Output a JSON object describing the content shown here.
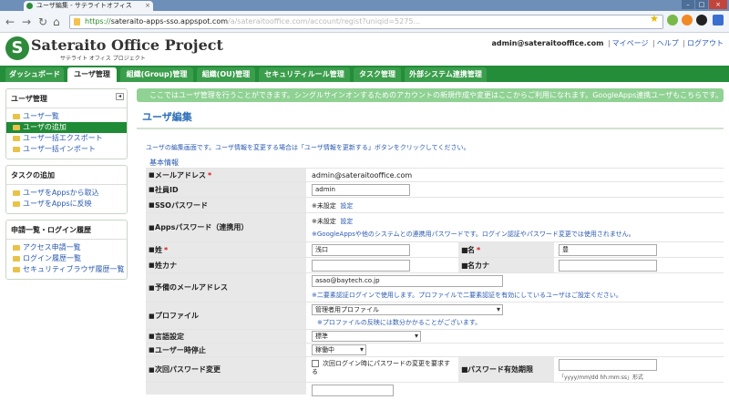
{
  "browser": {
    "tab_title": "ユーザ編集 - サテライトオフィス",
    "url_scheme": "https://",
    "url_host": "sateraito-apps-sso.appspot.com",
    "url_rest": "/a/sateraitooffice.com/account/regist?uniqid=5275..."
  },
  "header": {
    "brand": "Sateraito Office Project",
    "brand_sub": "サテライト オフィス プロジェクト",
    "user_email": "admin@sateraitooffice.com",
    "links": [
      "マイページ",
      "ヘルプ",
      "ログアウト"
    ]
  },
  "main_nav": [
    "ダッシュボード",
    "ユーザ管理",
    "組織(Group)管理",
    "組織(OU)管理",
    "セキュリティルール管理",
    "タスク管理",
    "外部システム連携管理"
  ],
  "sidebar": {
    "sections": [
      {
        "title": "ユーザ管理",
        "items": [
          "ユーザ一覧",
          "ユーザの追加",
          "ユーザ一括エクスポート",
          "ユーザ一括インポート"
        ]
      },
      {
        "title": "タスクの追加",
        "items": [
          "ユーザをAppsから取込",
          "ユーザをAppsに反映"
        ]
      },
      {
        "title": "申請一覧・ログイン履歴",
        "items": [
          "アクセス申請一覧",
          "ログイン履歴一覧",
          "セキュリティブラウザ履歴一覧"
        ]
      }
    ]
  },
  "info_bar": "ここではユーザ管理を行うことができます。シングルサインオンするためのアカウントの新規作成や変更はここからご利用になれます。GoogleApps連携ユーザもこちらです。",
  "page_title": "ユーザ編集",
  "description": "ユーザの編集画面です。ユーザ情報を変更する場合は「ユーザ情報を更新する」ボタンをクリックしてください。",
  "section_label": "基本情報",
  "form": {
    "email_label": "メールアドレス",
    "email_value": "admin@sateraitooffice.com",
    "employee_id_label": "社員ID",
    "employee_id_value": "admin",
    "sso_password_label": "SSOパスワード",
    "sso_password_status": "※未設定",
    "sso_password_link": "設定",
    "apps_password_label": "Appsパスワード（連携用）",
    "apps_password_status": "※未設定",
    "apps_password_link": "設定",
    "apps_password_note": "※GoogleAppsや他のシステムとの連携用パスワードです。ログイン認証やパスワード変更では使用されません。",
    "last_name_label": "姓",
    "last_name_value": "浅口",
    "first_name_label": "名",
    "first_name_value": "豊",
    "last_name_kana_label": "姓カナ",
    "last_name_kana_value": "",
    "first_name_kana_label": "名カナ",
    "first_name_kana_value": "",
    "backup_email_label": "予備のメールアドレス",
    "backup_email_value": "asao@baytech.co.jp",
    "backup_email_note": "※二要素認証ログインで使用します。プロファイルで二要素認証を有効にしているユーザはご設定ください。",
    "profile_label": "プロファイル",
    "profile_value": "管理者用プロファイル",
    "profile_note": "※プロファイルの反映には数分かかることがございます。",
    "language_label": "言語設定",
    "language_value": "標準",
    "suspend_label": "ユーザー時停止",
    "suspend_value": "稼働中",
    "next_pw_label": "次回パスワード変更",
    "next_pw_checkbox": "次回ログイン時にパスワードの変更を要求する",
    "pw_expiry_label": "パスワード有効期限",
    "pw_expiry_value": "",
    "pw_expiry_note": "「yyyy/mm/dd hh:mm:ss」形式"
  }
}
